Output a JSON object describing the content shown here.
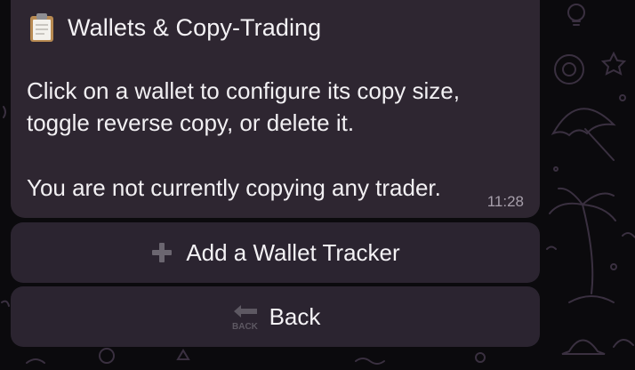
{
  "message": {
    "title": "Wallets & Copy-Trading",
    "title_icon": "clipboard-icon",
    "line_1": "Click on a wallet to configure its copy size,",
    "line_2": "toggle reverse copy, or delete it.",
    "line_3": "You are not currently copying any trader.",
    "time": "11:28"
  },
  "buttons": {
    "add_wallet": {
      "icon": "plus-icon",
      "label": "Add a Wallet Tracker"
    },
    "back": {
      "icon": "back-arrow-icon",
      "label": "Back",
      "icon_text": "BACK"
    }
  },
  "colors": {
    "background": "#0b0a0d",
    "bubble": "#2e2631",
    "button": "#2b2430",
    "text": "#f2f0f3",
    "timestamp": "#a79fab",
    "doodle": "#3a3040"
  }
}
